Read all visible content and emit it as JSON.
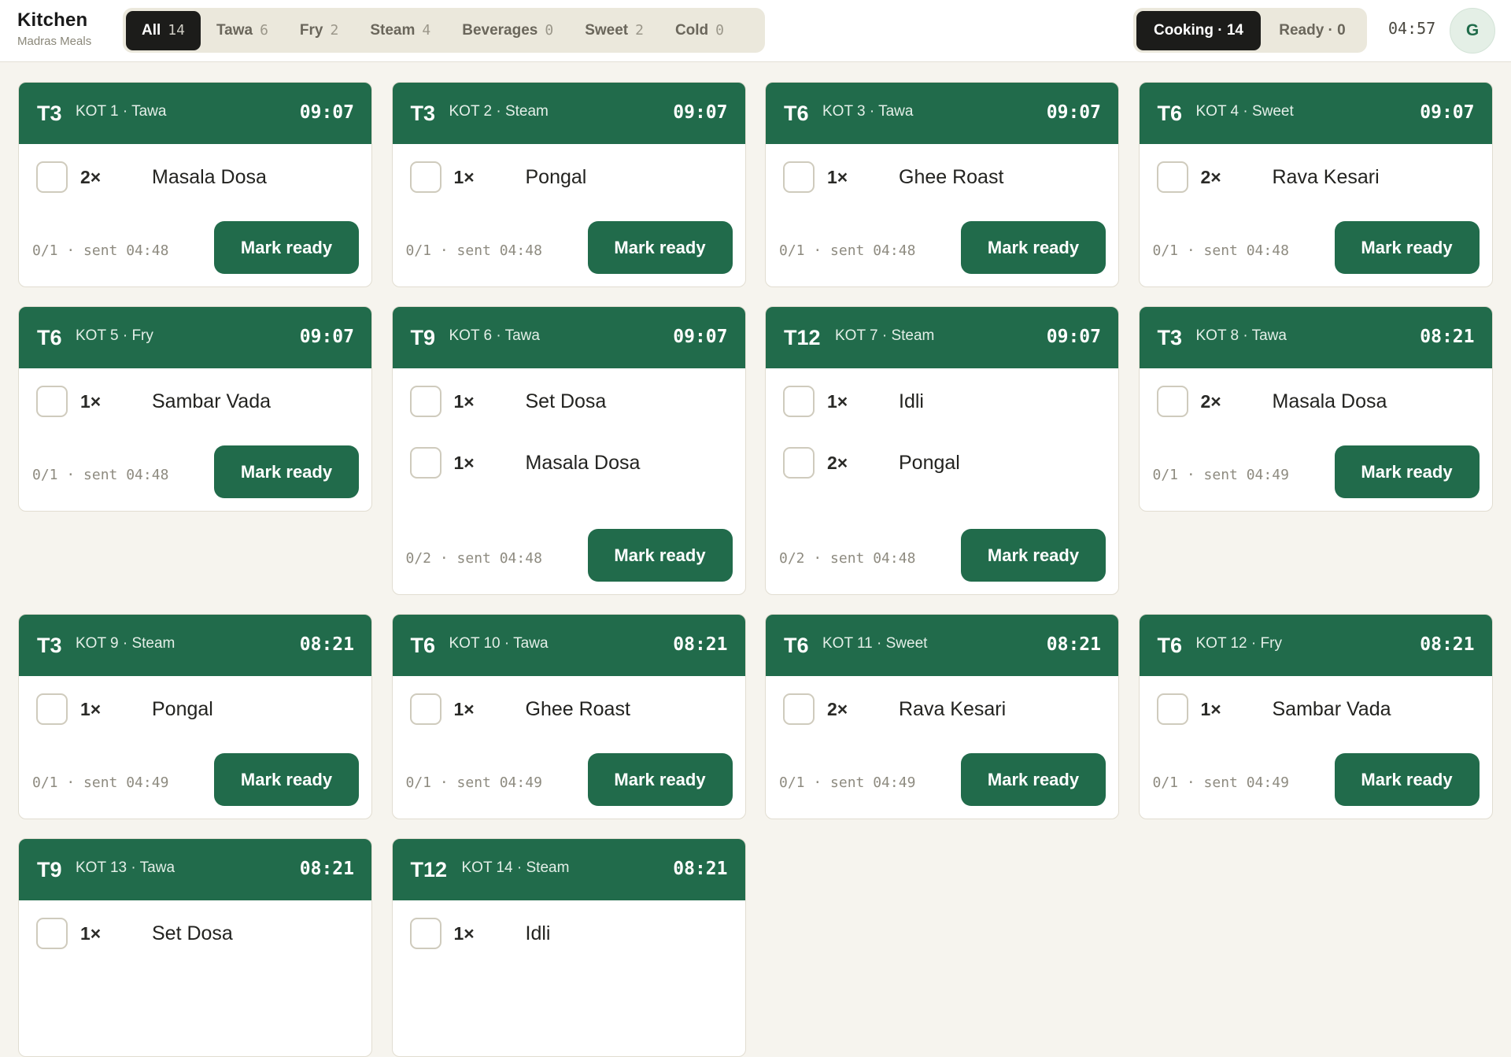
{
  "header": {
    "title": "Kitchen",
    "subtitle": "Madras Meals",
    "clock": "04:57",
    "avatar_initial": "G"
  },
  "filters": [
    {
      "label": "All",
      "count": "14",
      "active": true
    },
    {
      "label": "Tawa",
      "count": "6",
      "active": false
    },
    {
      "label": "Fry",
      "count": "2",
      "active": false
    },
    {
      "label": "Steam",
      "count": "4",
      "active": false
    },
    {
      "label": "Beverages",
      "count": "0",
      "active": false
    },
    {
      "label": "Sweet",
      "count": "2",
      "active": false
    },
    {
      "label": "Cold",
      "count": "0",
      "active": false
    }
  ],
  "status_toggle": {
    "cooking_label": "Cooking · 14",
    "ready_label": "Ready · 0"
  },
  "mark_ready_label": "Mark ready",
  "colors": {
    "accent_green": "#216b4b",
    "active_dark": "#1c1c1a",
    "background": "#f6f4ee"
  },
  "tickets": [
    {
      "table": "T3",
      "kot": "KOT 1 · Tawa",
      "time": "09:07",
      "progress": "0/1",
      "sent": "sent 04:48",
      "items": [
        {
          "qty": "2×",
          "name": "Masala Dosa"
        }
      ]
    },
    {
      "table": "T3",
      "kot": "KOT 2 · Steam",
      "time": "09:07",
      "progress": "0/1",
      "sent": "sent 04:48",
      "items": [
        {
          "qty": "1×",
          "name": "Pongal"
        }
      ]
    },
    {
      "table": "T6",
      "kot": "KOT 3 · Tawa",
      "time": "09:07",
      "progress": "0/1",
      "sent": "sent 04:48",
      "items": [
        {
          "qty": "1×",
          "name": "Ghee Roast"
        }
      ]
    },
    {
      "table": "T6",
      "kot": "KOT 4 · Sweet",
      "time": "09:07",
      "progress": "0/1",
      "sent": "sent 04:48",
      "items": [
        {
          "qty": "2×",
          "name": "Rava Kesari"
        }
      ]
    },
    {
      "table": "T6",
      "kot": "KOT 5 · Fry",
      "time": "09:07",
      "progress": "0/1",
      "sent": "sent 04:48",
      "items": [
        {
          "qty": "1×",
          "name": "Sambar Vada"
        }
      ]
    },
    {
      "table": "T9",
      "kot": "KOT 6 · Tawa",
      "time": "09:07",
      "progress": "0/2",
      "sent": "sent 04:48",
      "items": [
        {
          "qty": "1×",
          "name": "Set Dosa"
        },
        {
          "qty": "1×",
          "name": "Masala Dosa"
        }
      ]
    },
    {
      "table": "T12",
      "kot": "KOT 7 · Steam",
      "time": "09:07",
      "progress": "0/2",
      "sent": "sent 04:48",
      "items": [
        {
          "qty": "1×",
          "name": "Idli"
        },
        {
          "qty": "2×",
          "name": "Pongal"
        }
      ]
    },
    {
      "table": "T3",
      "kot": "KOT 8 · Tawa",
      "time": "08:21",
      "progress": "0/1",
      "sent": "sent 04:49",
      "items": [
        {
          "qty": "2×",
          "name": "Masala Dosa"
        }
      ]
    },
    {
      "table": "T3",
      "kot": "KOT 9 · Steam",
      "time": "08:21",
      "progress": "0/1",
      "sent": "sent 04:49",
      "items": [
        {
          "qty": "1×",
          "name": "Pongal"
        }
      ]
    },
    {
      "table": "T6",
      "kot": "KOT 10 · Tawa",
      "time": "08:21",
      "progress": "0/1",
      "sent": "sent 04:49",
      "items": [
        {
          "qty": "1×",
          "name": "Ghee Roast"
        }
      ]
    },
    {
      "table": "T6",
      "kot": "KOT 11 · Sweet",
      "time": "08:21",
      "progress": "0/1",
      "sent": "sent 04:49",
      "items": [
        {
          "qty": "2×",
          "name": "Rava Kesari"
        }
      ]
    },
    {
      "table": "T6",
      "kot": "KOT 12 · Fry",
      "time": "08:21",
      "progress": "0/1",
      "sent": "sent 04:49",
      "items": [
        {
          "qty": "1×",
          "name": "Sambar Vada"
        }
      ]
    },
    {
      "table": "T9",
      "kot": "KOT 13 · Tawa",
      "time": "08:21",
      "progress": "",
      "sent": "",
      "items": [
        {
          "qty": "1×",
          "name": "Set Dosa"
        }
      ]
    },
    {
      "table": "T12",
      "kot": "KOT 14 · Steam",
      "time": "08:21",
      "progress": "",
      "sent": "",
      "items": [
        {
          "qty": "1×",
          "name": "Idli"
        }
      ]
    }
  ]
}
